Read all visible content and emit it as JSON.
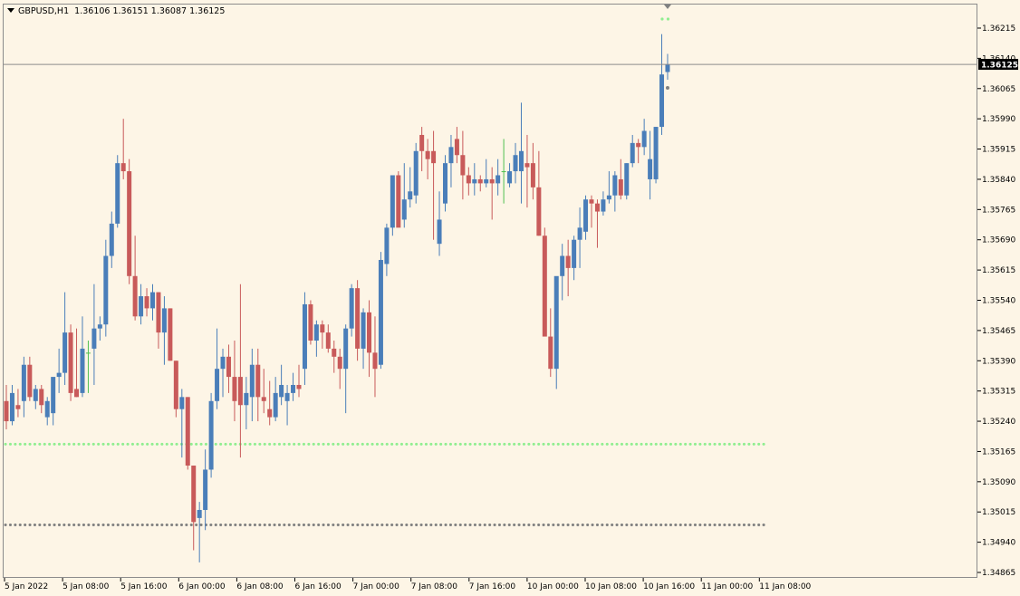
{
  "header": {
    "symbol": "GBPUSD,H1",
    "ohlc": "1.36106 1.36151 1.36087 1.36125"
  },
  "colors": {
    "background": "#fdf5e6",
    "bull": "#4a7eb9",
    "bear": "#c85a5a",
    "grid_axis": "#8c8c8c",
    "current_price_line": "#8c8c8c",
    "green_dots": "#90ee90",
    "gray_dots": "#808080"
  },
  "chart_data": {
    "type": "candlestick",
    "instrument": "GBPUSD",
    "timeframe": "H1",
    "ylim": [
      1.34865,
      1.36275
    ],
    "y_ticks": [
      "1.36215",
      "1.36140",
      "1.36065",
      "1.35990",
      "1.35915",
      "1.35840",
      "1.35765",
      "1.35690",
      "1.35615",
      "1.35540",
      "1.35465",
      "1.35390",
      "1.35315",
      "1.35240",
      "1.35165",
      "1.35090",
      "1.35015",
      "1.34940",
      "1.34865"
    ],
    "x_ticks": [
      "5 Jan 2022",
      "5 Jan 08:00",
      "5 Jan 16:00",
      "6 Jan 00:00",
      "6 Jan 08:00",
      "6 Jan 16:00",
      "7 Jan 00:00",
      "7 Jan 08:00",
      "7 Jan 16:00",
      "10 Jan 00:00",
      "10 Jan 08:00",
      "10 Jan 16:00",
      "11 Jan 00:00",
      "11 Jan 08:00"
    ],
    "current_price": "1.36125",
    "horizontal_levels": [
      {
        "price": 1.35183,
        "style": "dotted",
        "color": "#90ee90"
      },
      {
        "price": 1.34983,
        "style": "dotted",
        "color": "#808080"
      }
    ],
    "candles": [
      {
        "o": 1.3529,
        "h": 1.3533,
        "l": 1.3522,
        "c": 1.3524
      },
      {
        "o": 1.3524,
        "h": 1.3533,
        "l": 1.3523,
        "c": 1.3531
      },
      {
        "o": 1.3528,
        "h": 1.3532,
        "l": 1.3525,
        "c": 1.3527
      },
      {
        "o": 1.3529,
        "h": 1.354,
        "l": 1.3525,
        "c": 1.3538
      },
      {
        "o": 1.3538,
        "h": 1.354,
        "l": 1.3529,
        "c": 1.353
      },
      {
        "o": 1.3529,
        "h": 1.3533,
        "l": 1.3527,
        "c": 1.3532
      },
      {
        "o": 1.3532,
        "h": 1.3533,
        "l": 1.3526,
        "c": 1.3528
      },
      {
        "o": 1.3525,
        "h": 1.353,
        "l": 1.3523,
        "c": 1.3529
      },
      {
        "o": 1.3526,
        "h": 1.3532,
        "l": 1.3523,
        "c": 1.3535
      },
      {
        "o": 1.3535,
        "h": 1.3542,
        "l": 1.3531,
        "c": 1.3536
      },
      {
        "o": 1.3536,
        "h": 1.3556,
        "l": 1.3533,
        "c": 1.3546
      },
      {
        "o": 1.3546,
        "h": 1.3548,
        "l": 1.3529,
        "c": 1.3531
      },
      {
        "o": 1.3532,
        "h": 1.3547,
        "l": 1.353,
        "c": 1.353
      },
      {
        "o": 1.3531,
        "h": 1.355,
        "l": 1.353,
        "c": 1.3542
      },
      {
        "o": 1.3541,
        "h": 1.3544,
        "l": 1.3531,
        "c": 1.3541
      },
      {
        "o": 1.3542,
        "h": 1.3558,
        "l": 1.3533,
        "c": 1.3547
      },
      {
        "o": 1.3547,
        "h": 1.355,
        "l": 1.3544,
        "c": 1.3548
      },
      {
        "o": 1.3548,
        "h": 1.3569,
        "l": 1.3545,
        "c": 1.3565
      },
      {
        "o": 1.3565,
        "h": 1.3576,
        "l": 1.3562,
        "c": 1.3573
      },
      {
        "o": 1.3573,
        "h": 1.359,
        "l": 1.3572,
        "c": 1.3588
      },
      {
        "o": 1.3588,
        "h": 1.3599,
        "l": 1.3584,
        "c": 1.3586
      },
      {
        "o": 1.3586,
        "h": 1.3589,
        "l": 1.3558,
        "c": 1.356
      },
      {
        "o": 1.356,
        "h": 1.357,
        "l": 1.3549,
        "c": 1.355
      },
      {
        "o": 1.355,
        "h": 1.3558,
        "l": 1.3548,
        "c": 1.3555
      },
      {
        "o": 1.3555,
        "h": 1.3557,
        "l": 1.355,
        "c": 1.3552
      },
      {
        "o": 1.3552,
        "h": 1.3558,
        "l": 1.3549,
        "c": 1.3556
      },
      {
        "o": 1.3556,
        "h": 1.3556,
        "l": 1.3542,
        "c": 1.3546
      },
      {
        "o": 1.3546,
        "h": 1.3555,
        "l": 1.3538,
        "c": 1.3552
      },
      {
        "o": 1.3552,
        "h": 1.3552,
        "l": 1.3539,
        "c": 1.3539
      },
      {
        "o": 1.3539,
        "h": 1.3539,
        "l": 1.3525,
        "c": 1.3527
      },
      {
        "o": 1.3527,
        "h": 1.3532,
        "l": 1.3515,
        "c": 1.353
      },
      {
        "o": 1.353,
        "h": 1.353,
        "l": 1.3512,
        "c": 1.3513
      },
      {
        "o": 1.3513,
        "h": 1.3513,
        "l": 1.3492,
        "c": 1.3499
      },
      {
        "o": 1.35,
        "h": 1.3504,
        "l": 1.3489,
        "c": 1.3502
      },
      {
        "o": 1.3502,
        "h": 1.3517,
        "l": 1.3497,
        "c": 1.3512
      },
      {
        "o": 1.3512,
        "h": 1.3531,
        "l": 1.351,
        "c": 1.3529
      },
      {
        "o": 1.3529,
        "h": 1.3547,
        "l": 1.3527,
        "c": 1.3537
      },
      {
        "o": 1.3537,
        "h": 1.3542,
        "l": 1.353,
        "c": 1.354
      },
      {
        "o": 1.354,
        "h": 1.3543,
        "l": 1.3531,
        "c": 1.3535
      },
      {
        "o": 1.3535,
        "h": 1.3544,
        "l": 1.3524,
        "c": 1.3529
      },
      {
        "o": 1.3535,
        "h": 1.3558,
        "l": 1.3515,
        "c": 1.3528
      },
      {
        "o": 1.3528,
        "h": 1.3535,
        "l": 1.3522,
        "c": 1.3531
      },
      {
        "o": 1.353,
        "h": 1.3542,
        "l": 1.3524,
        "c": 1.3538
      },
      {
        "o": 1.3538,
        "h": 1.3542,
        "l": 1.3524,
        "c": 1.353
      },
      {
        "o": 1.353,
        "h": 1.3537,
        "l": 1.3526,
        "c": 1.3529
      },
      {
        "o": 1.3527,
        "h": 1.3534,
        "l": 1.3523,
        "c": 1.3525
      },
      {
        "o": 1.3525,
        "h": 1.3535,
        "l": 1.3524,
        "c": 1.3531
      },
      {
        "o": 1.353,
        "h": 1.3538,
        "l": 1.3528,
        "c": 1.3533
      },
      {
        "o": 1.3529,
        "h": 1.3533,
        "l": 1.3523,
        "c": 1.3531
      },
      {
        "o": 1.3531,
        "h": 1.3536,
        "l": 1.3529,
        "c": 1.3533
      },
      {
        "o": 1.3533,
        "h": 1.3538,
        "l": 1.353,
        "c": 1.3532
      },
      {
        "o": 1.3537,
        "h": 1.3556,
        "l": 1.3533,
        "c": 1.3553
      },
      {
        "o": 1.3553,
        "h": 1.3554,
        "l": 1.3543,
        "c": 1.3544
      },
      {
        "o": 1.3544,
        "h": 1.3549,
        "l": 1.354,
        "c": 1.3548
      },
      {
        "o": 1.3548,
        "h": 1.3549,
        "l": 1.3542,
        "c": 1.3546
      },
      {
        "o": 1.3546,
        "h": 1.3548,
        "l": 1.3541,
        "c": 1.3542
      },
      {
        "o": 1.3542,
        "h": 1.3544,
        "l": 1.3536,
        "c": 1.354
      },
      {
        "o": 1.354,
        "h": 1.3542,
        "l": 1.3532,
        "c": 1.3537
      },
      {
        "o": 1.3537,
        "h": 1.3548,
        "l": 1.3526,
        "c": 1.3547
      },
      {
        "o": 1.3547,
        "h": 1.3558,
        "l": 1.3545,
        "c": 1.3557
      },
      {
        "o": 1.3557,
        "h": 1.3559,
        "l": 1.3539,
        "c": 1.3542
      },
      {
        "o": 1.3542,
        "h": 1.3552,
        "l": 1.3537,
        "c": 1.3551
      },
      {
        "o": 1.3551,
        "h": 1.3554,
        "l": 1.3535,
        "c": 1.3541
      },
      {
        "o": 1.3541,
        "h": 1.355,
        "l": 1.353,
        "c": 1.3537
      },
      {
        "o": 1.3538,
        "h": 1.3566,
        "l": 1.3537,
        "c": 1.3564
      },
      {
        "o": 1.3563,
        "h": 1.3573,
        "l": 1.356,
        "c": 1.3572
      },
      {
        "o": 1.3572,
        "h": 1.3585,
        "l": 1.357,
        "c": 1.3585
      },
      {
        "o": 1.3585,
        "h": 1.3586,
        "l": 1.3578,
        "c": 1.3572
      },
      {
        "o": 1.3574,
        "h": 1.3588,
        "l": 1.3572,
        "c": 1.3579
      },
      {
        "o": 1.3579,
        "h": 1.3587,
        "l": 1.3577,
        "c": 1.3581
      },
      {
        "o": 1.358,
        "h": 1.3593,
        "l": 1.3578,
        "c": 1.3591
      },
      {
        "o": 1.3595,
        "h": 1.3597,
        "l": 1.3586,
        "c": 1.3591
      },
      {
        "o": 1.3591,
        "h": 1.3594,
        "l": 1.3584,
        "c": 1.3589
      },
      {
        "o": 1.3591,
        "h": 1.3596,
        "l": 1.3569,
        "c": 1.3588
      },
      {
        "o": 1.3568,
        "h": 1.3581,
        "l": 1.3565,
        "c": 1.3574
      },
      {
        "o": 1.3578,
        "h": 1.359,
        "l": 1.3576,
        "c": 1.3588
      },
      {
        "o": 1.3588,
        "h": 1.3595,
        "l": 1.3582,
        "c": 1.3592
      },
      {
        "o": 1.3594,
        "h": 1.3597,
        "l": 1.3588,
        "c": 1.359
      },
      {
        "o": 1.359,
        "h": 1.3596,
        "l": 1.3579,
        "c": 1.3585
      },
      {
        "o": 1.3585,
        "h": 1.3587,
        "l": 1.358,
        "c": 1.3583
      },
      {
        "o": 1.3583,
        "h": 1.3588,
        "l": 1.358,
        "c": 1.3584
      },
      {
        "o": 1.3584,
        "h": 1.3585,
        "l": 1.3581,
        "c": 1.3583
      },
      {
        "o": 1.3583,
        "h": 1.3589,
        "l": 1.3582,
        "c": 1.3584
      },
      {
        "o": 1.3584,
        "h": 1.3587,
        "l": 1.3574,
        "c": 1.3583
      },
      {
        "o": 1.3583,
        "h": 1.3589,
        "l": 1.358,
        "c": 1.3585
      },
      {
        "o": 1.3586,
        "h": 1.3594,
        "l": 1.3578,
        "c": 1.3586
      },
      {
        "o": 1.3583,
        "h": 1.3588,
        "l": 1.3582,
        "c": 1.3586
      },
      {
        "o": 1.3586,
        "h": 1.3593,
        "l": 1.3583,
        "c": 1.359
      },
      {
        "o": 1.3586,
        "h": 1.3603,
        "l": 1.3578,
        "c": 1.3591
      },
      {
        "o": 1.3588,
        "h": 1.3595,
        "l": 1.3577,
        "c": 1.3587
      },
      {
        "o": 1.3588,
        "h": 1.3593,
        "l": 1.3579,
        "c": 1.3582
      },
      {
        "o": 1.3582,
        "h": 1.3591,
        "l": 1.357,
        "c": 1.357
      },
      {
        "o": 1.357,
        "h": 1.3572,
        "l": 1.3546,
        "c": 1.3545
      },
      {
        "o": 1.3545,
        "h": 1.3552,
        "l": 1.3535,
        "c": 1.3537
      },
      {
        "o": 1.3537,
        "h": 1.3557,
        "l": 1.3532,
        "c": 1.356
      },
      {
        "o": 1.356,
        "h": 1.3568,
        "l": 1.3554,
        "c": 1.3565
      },
      {
        "o": 1.3565,
        "h": 1.3569,
        "l": 1.3555,
        "c": 1.3562
      },
      {
        "o": 1.3562,
        "h": 1.357,
        "l": 1.3559,
        "c": 1.3569
      },
      {
        "o": 1.3569,
        "h": 1.3577,
        "l": 1.3562,
        "c": 1.3572
      },
      {
        "o": 1.3571,
        "h": 1.358,
        "l": 1.3569,
        "c": 1.3579
      },
      {
        "o": 1.3579,
        "h": 1.358,
        "l": 1.3572,
        "c": 1.3578
      },
      {
        "o": 1.3578,
        "h": 1.3579,
        "l": 1.3567,
        "c": 1.3576
      },
      {
        "o": 1.3576,
        "h": 1.3581,
        "l": 1.3575,
        "c": 1.3579
      },
      {
        "o": 1.3579,
        "h": 1.3586,
        "l": 1.3578,
        "c": 1.358
      },
      {
        "o": 1.358,
        "h": 1.3586,
        "l": 1.3576,
        "c": 1.3585
      },
      {
        "o": 1.3584,
        "h": 1.3589,
        "l": 1.3579,
        "c": 1.358
      },
      {
        "o": 1.358,
        "h": 1.3588,
        "l": 1.3579,
        "c": 1.3588
      },
      {
        "o": 1.3588,
        "h": 1.3595,
        "l": 1.3587,
        "c": 1.3593
      },
      {
        "o": 1.3593,
        "h": 1.3594,
        "l": 1.3588,
        "c": 1.3592
      },
      {
        "o": 1.3592,
        "h": 1.3599,
        "l": 1.359,
        "c": 1.3596
      },
      {
        "o": 1.3584,
        "h": 1.3596,
        "l": 1.3579,
        "c": 1.3589
      },
      {
        "o": 1.3584,
        "h": 1.3597,
        "l": 1.3583,
        "c": 1.3597
      },
      {
        "o": 1.3597,
        "h": 1.362,
        "l": 1.3595,
        "c": 1.361
      },
      {
        "o": 1.36106,
        "h": 1.36151,
        "l": 1.36087,
        "c": 1.36125
      }
    ]
  }
}
